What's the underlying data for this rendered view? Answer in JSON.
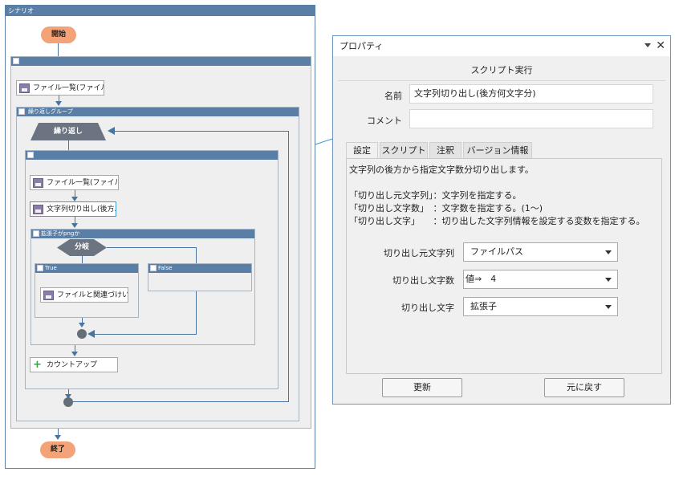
{
  "scenario": {
    "title": "シナリオ",
    "start_label": "開始",
    "end_label": "終了",
    "actions": {
      "file_list_1": "ファイル一覧(ファイル数...",
      "loop_group": "繰り返しグループ",
      "loop_label": "繰り返し",
      "file_list_2": "ファイル一覧(ファイル名...",
      "substring": "文字列切り出し(後方...",
      "cond_group": "拡張子がpngか",
      "branch_label": "分岐",
      "true_label": "True",
      "false_label": "False",
      "file_assoc": "ファイルと関連づけい...",
      "countup": "カウントアップ"
    }
  },
  "properties": {
    "panel_title": "プロパティ",
    "section_title": "スクリプト実行",
    "name_label": "名前",
    "name_value": "文字列切り出し(後方何文字分)",
    "comment_label": "コメント",
    "comment_value": "",
    "tabs": [
      "設定",
      "スクリプト",
      "注釈",
      "バージョン情報"
    ],
    "description": [
      "文字列の後方から指定文字数分切り出します。",
      "",
      "「切り出し元文字列」：文字列を指定する。",
      "「切り出し文字数」　：文字数を指定する。(1〜)",
      "「切り出し文字」　　：切り出した文字列情報を設定する変数を指定する。"
    ],
    "params": [
      {
        "label": "切り出し元文字列",
        "value": "ファイルパス"
      },
      {
        "label": "切り出し文字数",
        "value": "値⇒　4"
      },
      {
        "label": "切り出し文字",
        "value": "拡張子"
      }
    ],
    "update_button": "更新",
    "revert_button": "元に戻す"
  },
  "colors": {
    "header_blue": "#5a7fa6",
    "pill_orange": "#f3a377",
    "accent_line": "#3a9ad9"
  }
}
